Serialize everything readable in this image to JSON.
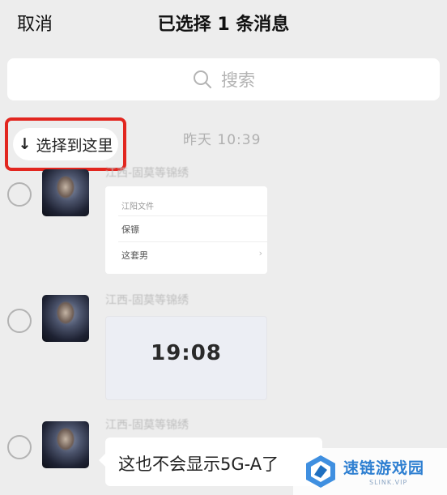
{
  "header": {
    "cancel_label": "取消",
    "title": "已选择 1 条消息"
  },
  "search": {
    "placeholder": "搜索",
    "icon": "search-icon"
  },
  "select_here": {
    "label": "选择到这里",
    "arrow": "↓"
  },
  "time_label": "昨天 10:39",
  "messages": [
    {
      "sender": "江西-固莫等锦绣",
      "type": "card",
      "card": {
        "title": "江阳文件",
        "row1": "保镖",
        "row2": "这套男"
      }
    },
    {
      "sender": "江西-固莫等锦绣",
      "type": "image",
      "image_text": "19:08"
    },
    {
      "sender": "江西-固莫等锦绣",
      "type": "text",
      "text": "这也不会显示5G-A了"
    }
  ],
  "watermark": {
    "title": "速链游戏园",
    "subtitle": "SLINK.VIP",
    "accent": "#2e7fd1"
  },
  "colors": {
    "background": "#ededed",
    "highlight_border": "#e2261f"
  }
}
